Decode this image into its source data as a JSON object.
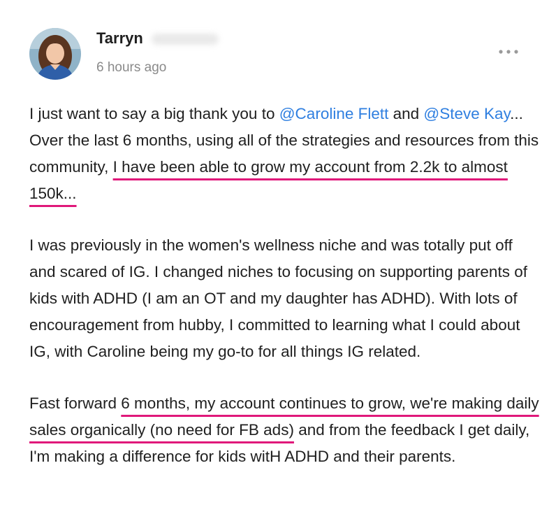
{
  "author": {
    "first_name": "Tarryn",
    "timestamp": "6 hours ago"
  },
  "icons": {
    "avatar": "profile-photo",
    "more": "more-horizontal-icon"
  },
  "colors": {
    "mention": "#2f7fe0",
    "highlight_underline": "#e0187a",
    "timestamp": "#8a8a8a"
  },
  "post": {
    "p1": {
      "t1": "I just want to say a big thank you to ",
      "mention1": "@Caroline Flett",
      "t2": " and ",
      "mention2": "@Steve Kay",
      "t3": "... Over the last 6 months, using all of the strategies and resources from this community, ",
      "highlight": "I have been able to grow my account from 2.2k to almost 150k..."
    },
    "p2": "I was previously in the women's wellness niche and was totally put off and scared of IG. I changed niches to focusing on supporting parents of kids with ADHD (I am an OT and my daughter has ADHD). With lots of encouragement from hubby, I committed to learning what I could about IG, with Caroline being my go-to for all things IG related.",
    "p3": {
      "t1": "Fast forward ",
      "highlight": "6 months, my account continues to grow, we're making daily sales organically (no need for FB ads)",
      "t2": " and from the feedback I get daily, I'm making a difference for kids witH ADHD and their parents."
    }
  }
}
